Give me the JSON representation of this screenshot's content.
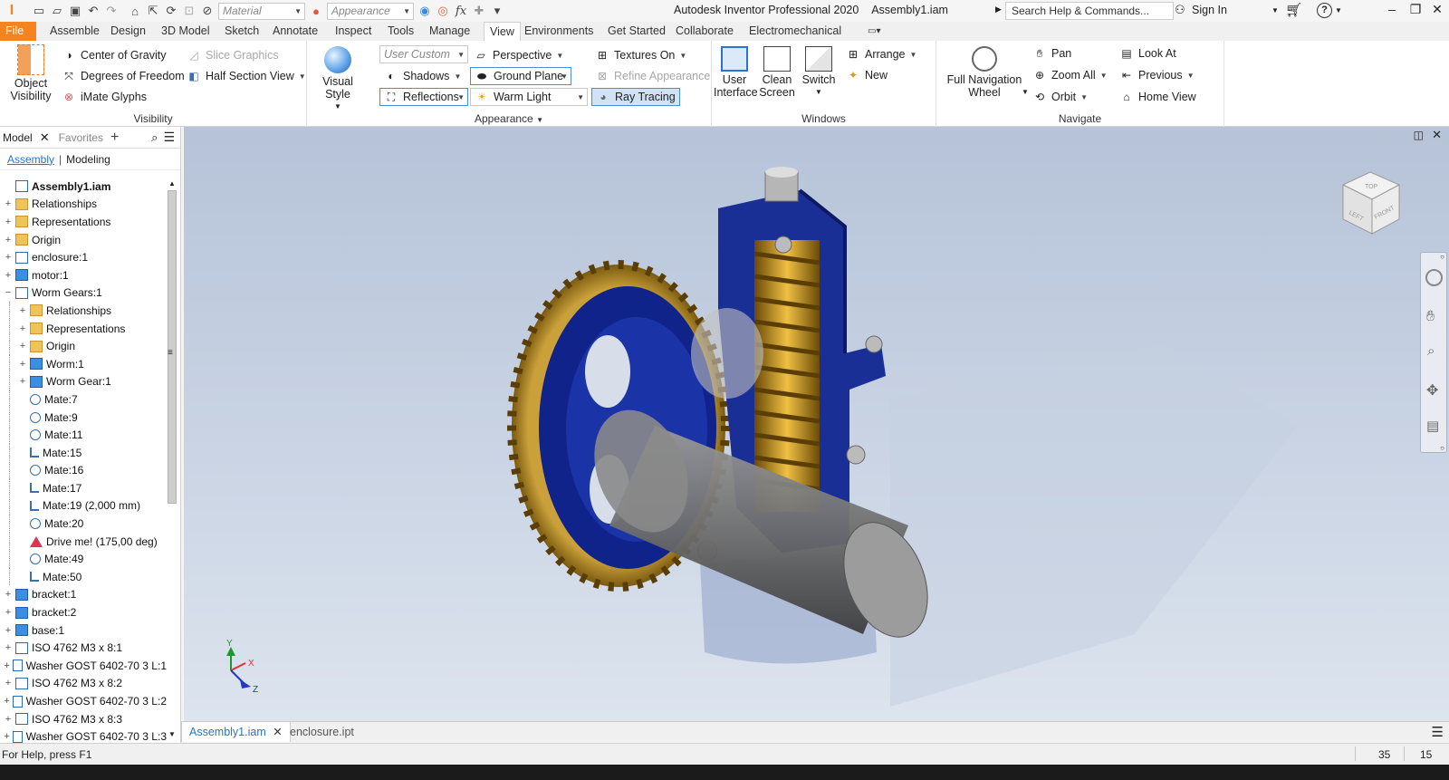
{
  "app": {
    "title": "Autodesk Inventor Professional 2020",
    "document": "Assembly1.iam"
  },
  "quick_access": {
    "material_combo": "Material",
    "appearance_combo": "Appearance"
  },
  "search": {
    "placeholder": "Search Help & Commands..."
  },
  "account": {
    "sign_in": "Sign In"
  },
  "tabs": [
    "File",
    "Assemble",
    "Design",
    "3D Model",
    "Sketch",
    "Annotate",
    "Inspect",
    "Tools",
    "Manage",
    "View",
    "Environments",
    "Get Started",
    "Collaborate",
    "Electromechanical"
  ],
  "active_tab": "View",
  "ribbon": {
    "visibility": {
      "title": "Visibility",
      "object_visibility_l1": "Object",
      "object_visibility_l2": "Visibility",
      "center_of_gravity": "Center of Gravity",
      "degrees_of_freedom": "Degrees of Freedom",
      "imate_glyphs": "iMate Glyphs",
      "slice_graphics": "Slice Graphics",
      "half_section_view": "Half Section View"
    },
    "appearance": {
      "title": "Appearance",
      "visual_style": "Visual Style",
      "user_custom": "User Custom",
      "shadows": "Shadows",
      "reflections": "Reflections",
      "perspective": "Perspective",
      "ground_plane": "Ground Plane",
      "warm_light": "Warm Light",
      "textures_on": "Textures On",
      "refine_appearance": "Refine Appearance",
      "ray_tracing": "Ray Tracing"
    },
    "windows": {
      "title": "Windows",
      "user_interface_l1": "User",
      "user_interface_l2": "Interface",
      "clean_screen_l1": "Clean",
      "clean_screen_l2": "Screen",
      "switch": "Switch",
      "arrange": "Arrange",
      "new": "New"
    },
    "navigate": {
      "title": "Navigate",
      "full_nav_l1": "Full Navigation",
      "full_nav_l2": "Wheel",
      "pan": "Pan",
      "zoom_all": "Zoom All",
      "orbit": "Orbit",
      "look_at": "Look At",
      "previous": "Previous",
      "home_view": "Home View"
    }
  },
  "browser": {
    "tab_model": "Model",
    "tab_favorites": "Favorites",
    "sub_assembly": "Assembly",
    "sub_modeling": "Modeling",
    "tree": [
      {
        "label": "Assembly1.iam",
        "icon": "asm",
        "indent": 0,
        "exp": "",
        "bold": true
      },
      {
        "label": "Relationships",
        "icon": "folder",
        "indent": 0,
        "exp": "+"
      },
      {
        "label": "Representations",
        "icon": "folder",
        "indent": 0,
        "exp": "+"
      },
      {
        "label": "Origin",
        "icon": "folder",
        "indent": 0,
        "exp": "+"
      },
      {
        "label": "enclosure:1",
        "icon": "asm",
        "indent": 0,
        "exp": "+"
      },
      {
        "label": "motor:1",
        "icon": "part",
        "indent": 0,
        "exp": "+"
      },
      {
        "label": "Worm Gears:1",
        "icon": "asm",
        "indent": 0,
        "exp": "−"
      },
      {
        "label": "Relationships",
        "icon": "folder",
        "indent": 1,
        "exp": "+"
      },
      {
        "label": "Representations",
        "icon": "folder",
        "indent": 1,
        "exp": "+"
      },
      {
        "label": "Origin",
        "icon": "folder",
        "indent": 1,
        "exp": "+"
      },
      {
        "label": "Worm:1",
        "icon": "part",
        "indent": 1,
        "exp": "+"
      },
      {
        "label": "Worm Gear:1",
        "icon": "part",
        "indent": 1,
        "exp": "+"
      },
      {
        "label": "Mate:7",
        "icon": "mate",
        "indent": 1,
        "exp": ""
      },
      {
        "label": "Mate:9",
        "icon": "mate",
        "indent": 1,
        "exp": ""
      },
      {
        "label": "Mate:11",
        "icon": "mate",
        "indent": 1,
        "exp": ""
      },
      {
        "label": "Mate:15",
        "icon": "mateL",
        "indent": 1,
        "exp": ""
      },
      {
        "label": "Mate:16",
        "icon": "mate",
        "indent": 1,
        "exp": ""
      },
      {
        "label": "Mate:17",
        "icon": "mateL",
        "indent": 1,
        "exp": ""
      },
      {
        "label": "Mate:19 (2,000 mm)",
        "icon": "mateL",
        "indent": 1,
        "exp": ""
      },
      {
        "label": "Mate:20",
        "icon": "mate",
        "indent": 1,
        "exp": ""
      },
      {
        "label": "Drive me! (175,00 deg)",
        "icon": "drive",
        "indent": 1,
        "exp": ""
      },
      {
        "label": "Mate:49",
        "icon": "mate",
        "indent": 1,
        "exp": ""
      },
      {
        "label": "Mate:50",
        "icon": "mateL",
        "indent": 1,
        "exp": ""
      },
      {
        "label": "bracket:1",
        "icon": "part",
        "indent": 0,
        "exp": "+"
      },
      {
        "label": "bracket:2",
        "icon": "part",
        "indent": 0,
        "exp": "+"
      },
      {
        "label": "base:1",
        "icon": "part",
        "indent": 0,
        "exp": "+"
      },
      {
        "label": "ISO 4762 M3 x 8:1",
        "icon": "asm",
        "indent": 0,
        "exp": "+"
      },
      {
        "label": "Washer GOST 6402-70 3 L:1",
        "icon": "asm",
        "indent": 0,
        "exp": "+"
      },
      {
        "label": "ISO 4762 M3 x 8:2",
        "icon": "asm",
        "indent": 0,
        "exp": "+"
      },
      {
        "label": "Washer GOST 6402-70 3 L:2",
        "icon": "asm",
        "indent": 0,
        "exp": "+"
      },
      {
        "label": "ISO 4762 M3 x 8:3",
        "icon": "asm",
        "indent": 0,
        "exp": "+"
      },
      {
        "label": "Washer GOST 6402-70 3 L:3",
        "icon": "asm",
        "indent": 0,
        "exp": "+"
      }
    ]
  },
  "viewcube": {
    "top": "TOP",
    "left": "LEFT",
    "front": "FRONT"
  },
  "triad": {
    "x": "X",
    "y": "Y",
    "z": "Z"
  },
  "doc_tabs": [
    {
      "label": "Assembly1.iam",
      "active": true
    },
    {
      "label": "enclosure.ipt",
      "active": false
    }
  ],
  "status": {
    "help": "For Help, press F1",
    "count1": "35",
    "count2": "15"
  },
  "colors": {
    "file_tab": "#f5841f",
    "accent_blue": "#2a74c9",
    "bracket_blue": "#1f3a9a",
    "gear_gold": "#d9a82a"
  }
}
